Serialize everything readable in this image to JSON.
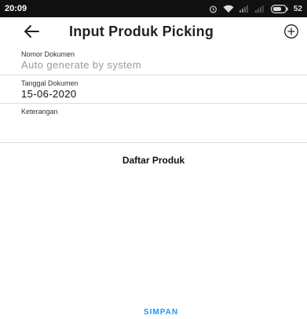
{
  "status_bar": {
    "time": "20:09",
    "battery_percent": "52"
  },
  "app_bar": {
    "title": "Input Produk Picking",
    "back_icon": "arrow-left-icon",
    "add_icon": "plus-circle-icon"
  },
  "form": {
    "nomor_dokumen": {
      "label": "Nomor Dokumen",
      "placeholder": "Auto generate by system"
    },
    "tanggal_dokumen": {
      "label": "Tanggal Dokumen",
      "value": "15-06-2020"
    },
    "keterangan": {
      "label": "Keterangan",
      "value": ""
    }
  },
  "product_list": {
    "title": "Daftar Produk"
  },
  "actions": {
    "save_label": "SIMPAN"
  },
  "colors": {
    "accent": "#2196f3",
    "status_bar_bg": "#111111",
    "divider": "#dcdcdc"
  }
}
